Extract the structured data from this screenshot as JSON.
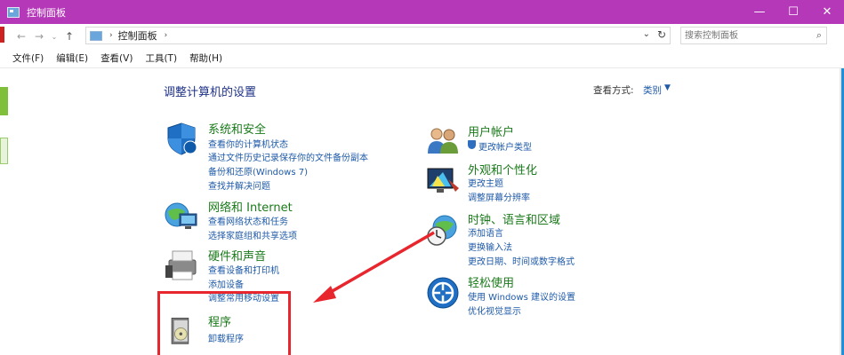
{
  "window": {
    "title": "控制面板",
    "minimize": "—",
    "maximize": "☐",
    "close": "✕"
  },
  "address": {
    "crumb": "控制面板",
    "search_placeholder": "搜索控制面板"
  },
  "menu": [
    "文件(F)",
    "编辑(E)",
    "查看(V)",
    "工具(T)",
    "帮助(H)"
  ],
  "content": {
    "title": "调整计算机的设置",
    "view_label": "查看方式:",
    "view_value": "类别"
  },
  "categories": {
    "system": {
      "title": "系统和安全",
      "links": [
        "查看你的计算机状态",
        "通过文件历史记录保存你的文件备份副本",
        "备份和还原(Windows 7)",
        "查找并解决问题"
      ]
    },
    "network": {
      "title": "网络和 Internet",
      "links": [
        "查看网络状态和任务",
        "选择家庭组和共享选项"
      ]
    },
    "hardware": {
      "title": "硬件和声音",
      "links": [
        "查看设备和打印机",
        "添加设备",
        "调整常用移动设置"
      ]
    },
    "programs": {
      "title": "程序",
      "links": [
        "卸载程序"
      ]
    },
    "users": {
      "title": "用户帐户",
      "links": [
        "更改帐户类型"
      ]
    },
    "appearance": {
      "title": "外观和个性化",
      "links": [
        "更改主题",
        "调整屏幕分辨率"
      ]
    },
    "clock": {
      "title": "时钟、语言和区域",
      "links": [
        "添加语言",
        "更换输入法",
        "更改日期、时间或数字格式"
      ]
    },
    "ease": {
      "title": "轻松使用",
      "links": [
        "使用 Windows 建议的设置",
        "优化视觉显示"
      ]
    }
  },
  "colors": {
    "titlebar": "#b538b8",
    "category_title": "#1a7a1a",
    "link": "#1e5aa8",
    "annotation": "#e8262d"
  }
}
